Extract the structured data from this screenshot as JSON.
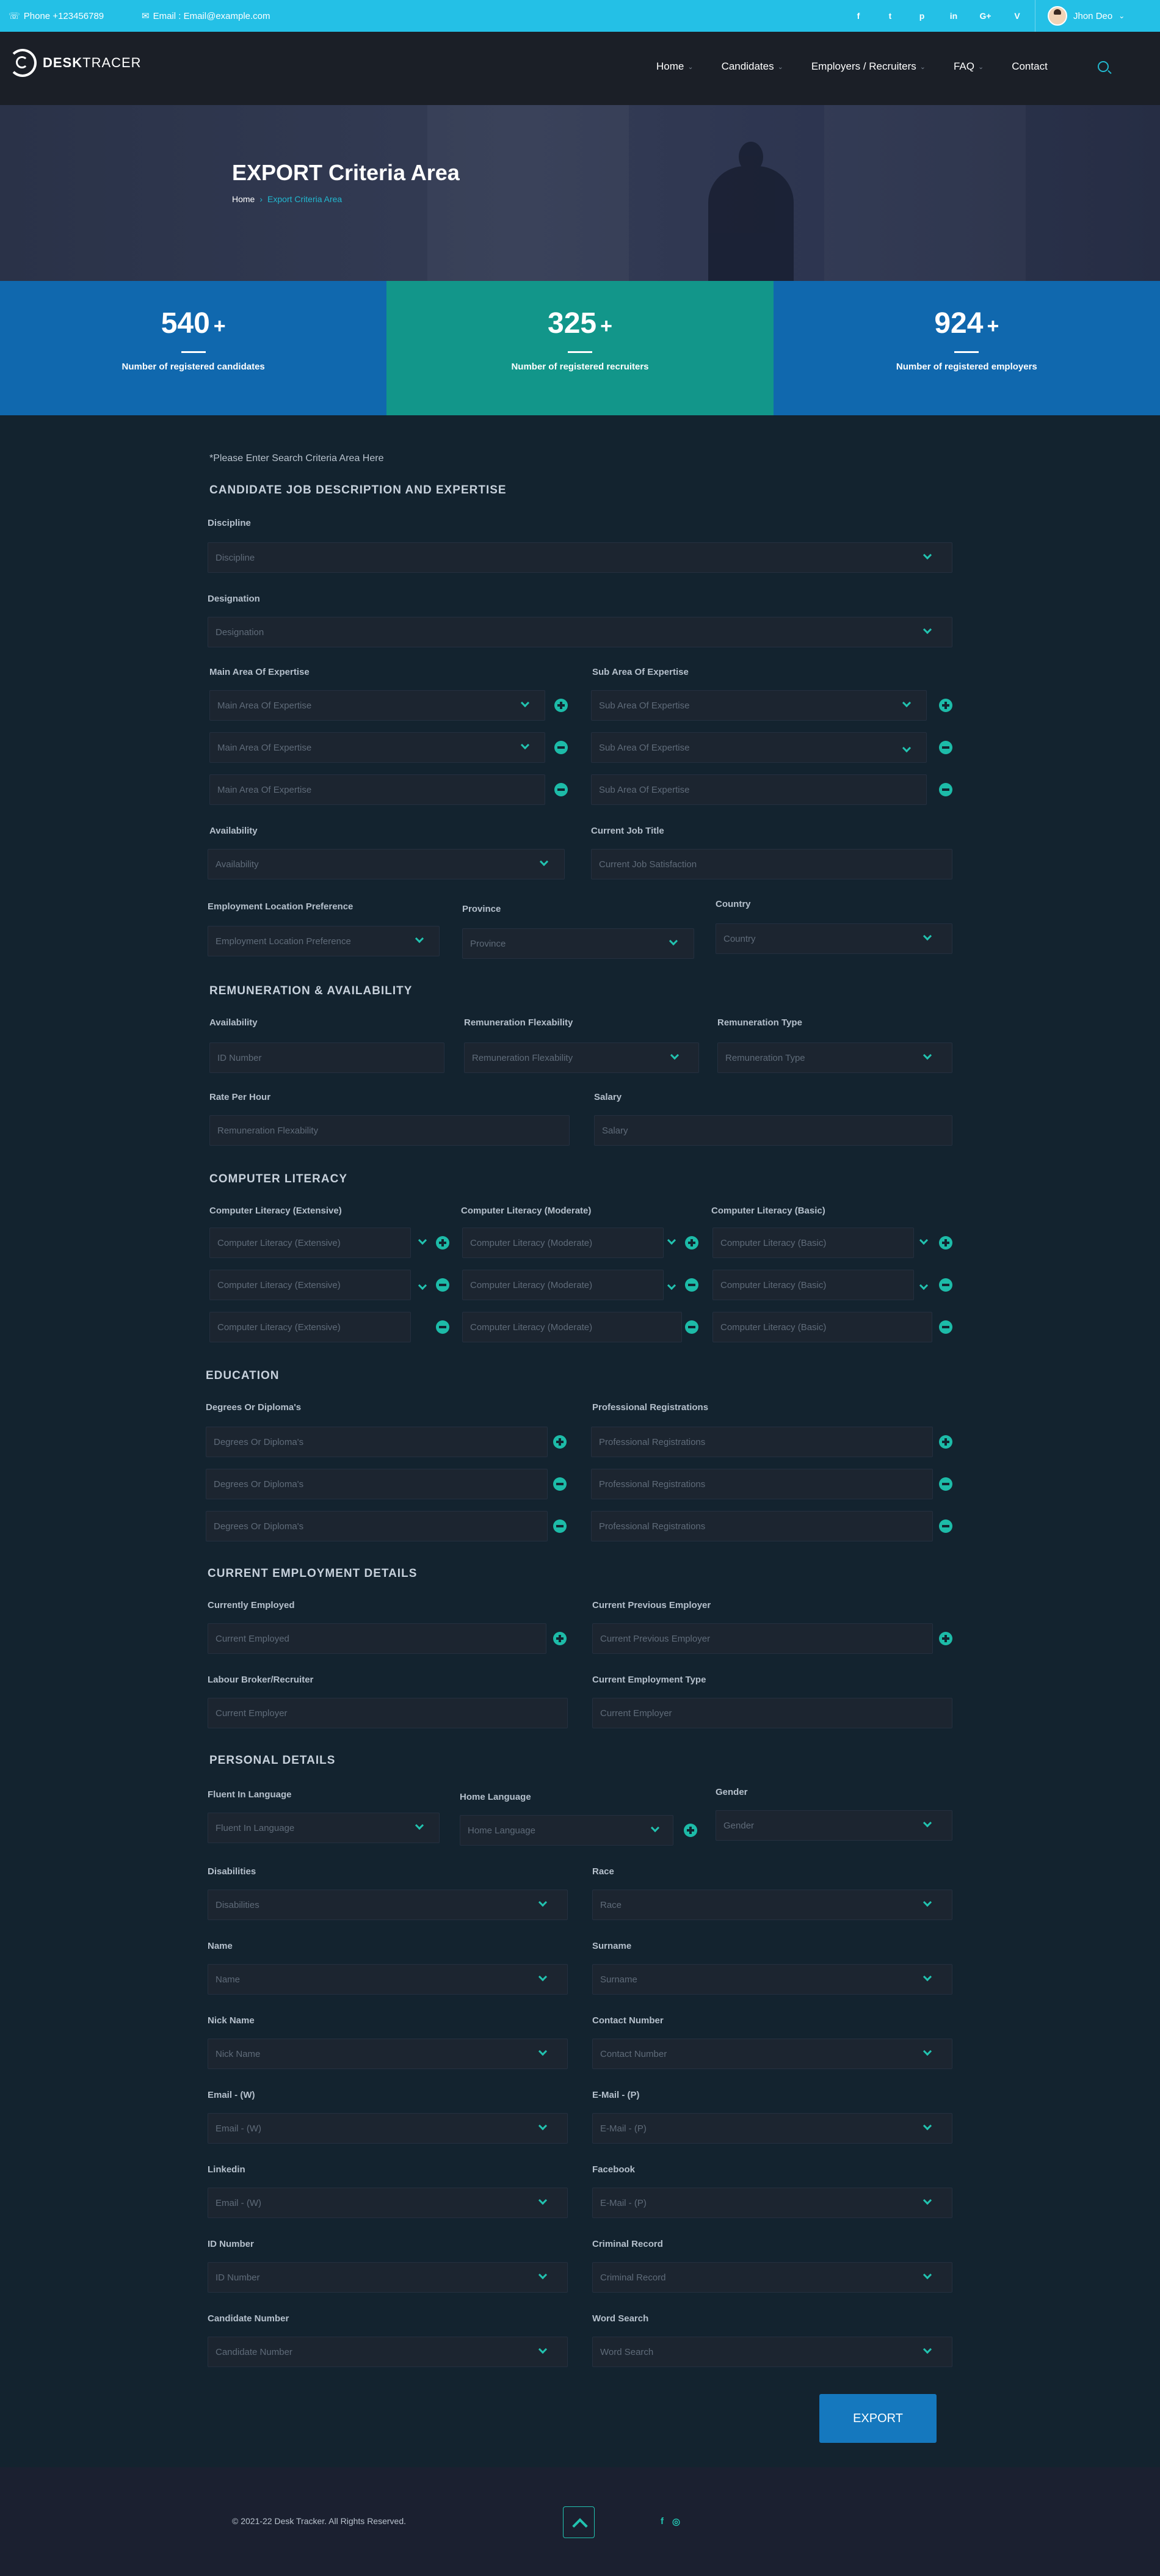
{
  "topbar": {
    "phone": "Phone +123456789",
    "email": "Email : Email@example.com",
    "social": [
      "f",
      "t",
      "p",
      "in",
      "G+",
      "V"
    ],
    "user_name": "Jhon Deo"
  },
  "brand": {
    "bold": "DESK",
    "light": "TRACER"
  },
  "menu": [
    {
      "label": "Home",
      "caret": "⌄"
    },
    {
      "label": "Candidates",
      "caret": "⌄"
    },
    {
      "label": "Employers / Recruiters",
      "caret": "⌄"
    },
    {
      "label": "FAQ",
      "caret": "⌄"
    },
    {
      "label": "Contact",
      "caret": ""
    }
  ],
  "hero": {
    "title": "EXPORT Criteria Area",
    "crumb_home": "Home",
    "crumb_sep": "›",
    "crumb_current": "Export Criteria Area"
  },
  "stats": [
    {
      "value": "540",
      "plus": "+",
      "label": "Number of registered candidates",
      "color": "#1068ae"
    },
    {
      "value": "325",
      "plus": "+",
      "label": "Number of registered recruiters",
      "color": "#12968a"
    },
    {
      "value": "924",
      "plus": "+",
      "label": "Number of registered employers",
      "color": "#1068ae"
    }
  ],
  "form": {
    "note": "*Please Enter Search Criteria Area Here",
    "s1": "CANDIDATE JOB DESCRIPTION AND EXPERTISE",
    "discipline": "Discipline",
    "designation": "Designation",
    "main_area": "Main Area Of Expertise",
    "sub_area": "Sub Area Of Expertise",
    "availability": "Availability",
    "current_job_title": "Current Job Title",
    "current_job_satisfaction": "Current Job Satisfaction",
    "employment_location": "Employment Location Preference",
    "province": "Province",
    "country": "Country",
    "s2": "REMUNERATION & AVAILABILITY",
    "id_number_ph": "ID Number",
    "remuneration_flex": "Remuneration Flexability",
    "remuneration_type": "Remuneration Type",
    "rate_per_hour": "Rate Per Hour",
    "salary": "Salary",
    "s3": "COMPUTER LITERACY",
    "cl_ext": "Computer Literacy (Extensive)",
    "cl_mod": "Computer Literacy (Moderate)",
    "cl_bas": "Computer Literacy (Basic)",
    "s4": "EDUCATION",
    "degrees": "Degrees Or Diploma's",
    "prof_reg": "Professional Registrations",
    "s5": "CURRENT EMPLOYMENT DETAILS",
    "currently_employed": "Currently Employed",
    "current_employed_ph": "Current Employed",
    "current_prev_employer": "Current Previous Employer",
    "labour_broker": "Labour Broker/Recruiter",
    "current_employer_ph": "Current Employer",
    "current_employment_type": "Current Employment Type",
    "s6": "PERSONAL DETAILS",
    "fluent_language": "Fluent In Language",
    "home_language": "Home Language",
    "gender": "Gender",
    "disabilities": "Disabilities",
    "race": "Race",
    "name": "Name",
    "surname": "Surname",
    "nick_name": "Nick Name",
    "contact_number": "Contact Number",
    "email_w": "Email - (W)",
    "email_p": "E-Mail - (P)",
    "linkedin": "Linkedin",
    "facebook": "Facebook",
    "id_number": "ID Number",
    "criminal_record": "Criminal Record",
    "candidate_number": "Candidate Number",
    "word_search": "Word Search",
    "export": "EXPORT"
  },
  "footer": {
    "copy": "© 2021-22 Desk Tracker. All Rights Reserved.",
    "social": [
      "f",
      "◎"
    ]
  }
}
